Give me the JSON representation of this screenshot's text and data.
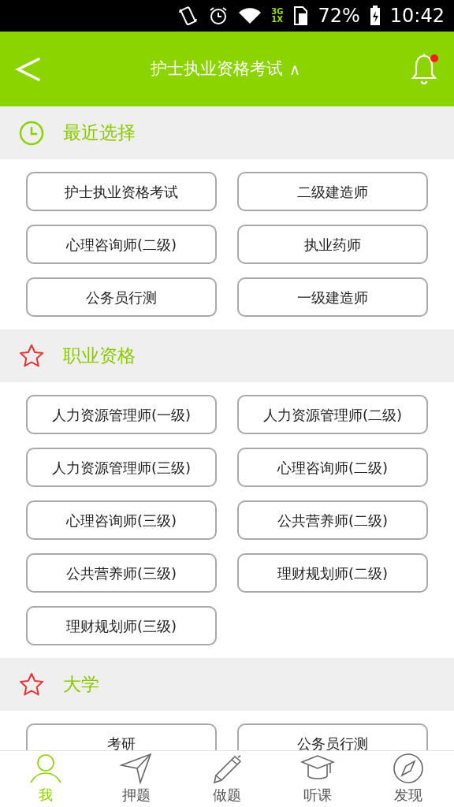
{
  "status_bar": {
    "network_top": "3G",
    "network_bottom": "1X",
    "battery": "72%",
    "time": "10:42"
  },
  "header": {
    "title": "护士执业资格考试",
    "caret": "∧",
    "notification": true
  },
  "sections": [
    {
      "kind": "recent",
      "title": "最近选择",
      "items": [
        "护士执业资格考试",
        "二级建造师",
        "心理咨询师(二级)",
        "执业药师",
        "公务员行测",
        "一级建造师"
      ]
    },
    {
      "kind": "starred",
      "title": "职业资格",
      "items": [
        "人力资源管理师(一级)",
        "人力资源管理师(二级)",
        "人力资源管理师(三级)",
        "心理咨询师(二级)",
        "心理咨询师(三级)",
        "公共营养师(二级)",
        "公共营养师(三级)",
        "理财规划师(二级)",
        "理财规划师(三级)"
      ]
    },
    {
      "kind": "starred",
      "title": "大学",
      "items": [
        "考研",
        "公务员行测"
      ]
    }
  ],
  "nav": [
    {
      "kind": "person",
      "label": "我",
      "selected": true
    },
    {
      "kind": "send",
      "label": "押题",
      "selected": false
    },
    {
      "kind": "pen",
      "label": "做题",
      "selected": false
    },
    {
      "kind": "cap",
      "label": "听课",
      "selected": false
    },
    {
      "kind": "compass",
      "label": "发现",
      "selected": false
    }
  ]
}
